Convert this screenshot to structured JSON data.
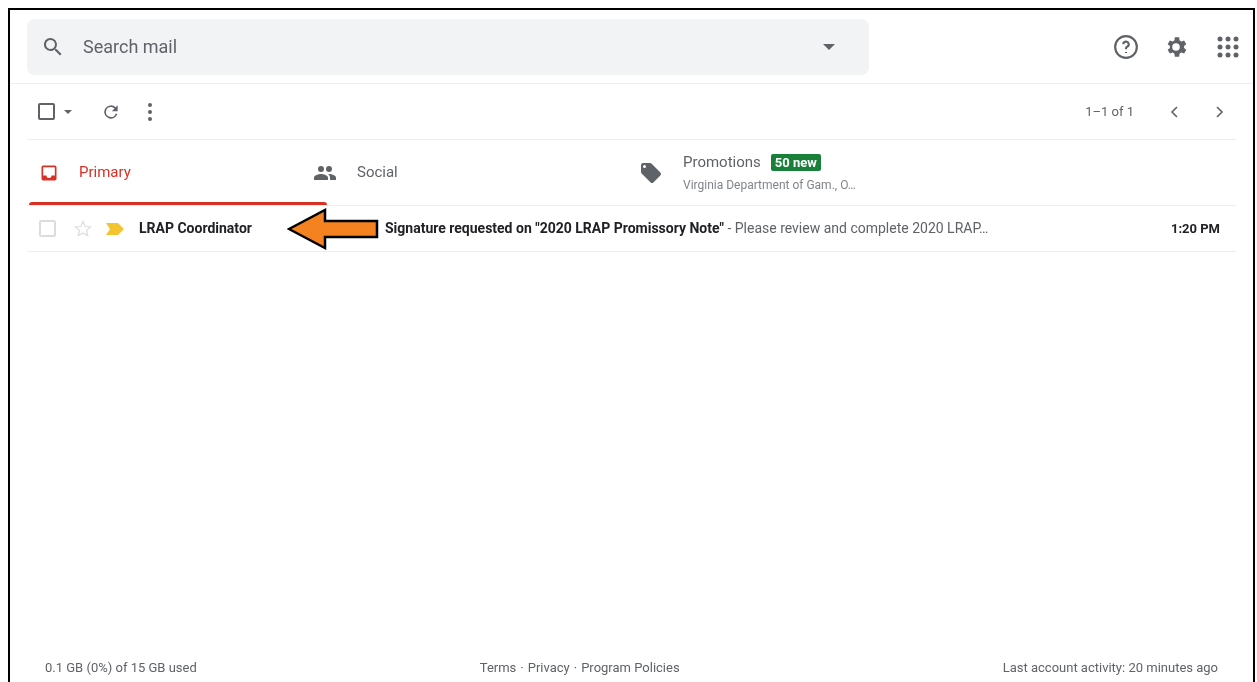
{
  "search": {
    "placeholder": "Search mail"
  },
  "toolbar": {
    "select_all_checked": false,
    "pagination": "1–1 of 1"
  },
  "tabs": [
    {
      "label": "Primary",
      "selected": true,
      "kind": "primary"
    },
    {
      "label": "Social",
      "selected": false,
      "kind": "social"
    },
    {
      "label": "Promotions",
      "selected": false,
      "kind": "promotions",
      "badge": "50 new",
      "subtitle": "Virginia Department of Gam., O…"
    }
  ],
  "emails": [
    {
      "checked": false,
      "starred": false,
      "important": true,
      "unread": true,
      "sender": "LRAP Coordinator",
      "subject": "Signature requested on \"2020 LRAP Promissory Note\"",
      "snippet": " - Please review and complete 2020 LRAP…",
      "time": "1:20 PM"
    }
  ],
  "footer": {
    "storage": "0.1 GB (0%) of 15 GB used",
    "links": [
      "Terms",
      "Privacy",
      "Program Policies"
    ],
    "separator": "·",
    "activity": "Last account activity: 20 minutes ago"
  }
}
